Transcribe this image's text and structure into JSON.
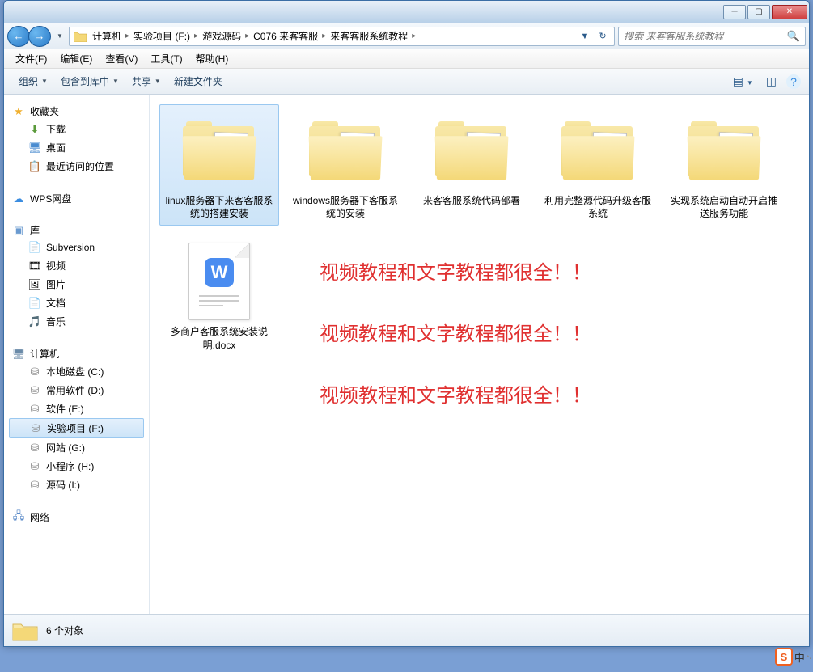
{
  "titlebar": {
    "minimize": "─",
    "maximize": "▢",
    "close": "✕"
  },
  "nav": {
    "back": "←",
    "forward": "→",
    "refresh": "↻",
    "dropdown": "▼"
  },
  "breadcrumbs": [
    "计算机",
    "实验项目 (F:)",
    "游戏源码",
    "C076 来客客服",
    "来客客服系统教程"
  ],
  "search": {
    "placeholder": "搜索 来客客服系统教程",
    "icon": "🔍"
  },
  "menubar": [
    "文件(F)",
    "编辑(E)",
    "查看(V)",
    "工具(T)",
    "帮助(H)"
  ],
  "toolbar": {
    "organize": "组织",
    "include": "包含到库中",
    "share": "共享",
    "newfolder": "新建文件夹",
    "help": "?"
  },
  "sidebar": {
    "favorites": {
      "label": "收藏夹",
      "items": [
        {
          "icon": "⬇",
          "label": "下载",
          "color": "#5a9a3a"
        },
        {
          "icon": "🖥",
          "label": "桌面",
          "color": "#4a8cd0"
        },
        {
          "icon": "📋",
          "label": "最近访问的位置",
          "color": "#8a6a4a"
        }
      ]
    },
    "wps": {
      "icon": "☁",
      "label": "WPS网盘",
      "color": "#3a8ce0"
    },
    "libraries": {
      "label": "库",
      "items": [
        {
          "icon": "📄",
          "label": "Subversion"
        },
        {
          "icon": "🎞",
          "label": "视频"
        },
        {
          "icon": "🖼",
          "label": "图片"
        },
        {
          "icon": "📄",
          "label": "文档"
        },
        {
          "icon": "🎵",
          "label": "音乐",
          "color": "#4a9ae0"
        }
      ]
    },
    "computer": {
      "label": "计算机",
      "items": [
        {
          "label": "本地磁盘 (C:)"
        },
        {
          "label": "常用软件 (D:)"
        },
        {
          "label": "软件 (E:)"
        },
        {
          "label": "实验项目 (F:)",
          "selected": true
        },
        {
          "label": "网站 (G:)"
        },
        {
          "label": "小程序 (H:)"
        },
        {
          "label": "源码 (I:)"
        }
      ]
    },
    "network": {
      "icon": "🖧",
      "label": "网络"
    }
  },
  "files": [
    {
      "type": "folder",
      "label": "linux服务器下来客客服系统的搭建安装",
      "selected": true
    },
    {
      "type": "folder",
      "label": "windows服务器下客服系统的安装"
    },
    {
      "type": "folder",
      "label": "来客客服系统代码部署"
    },
    {
      "type": "folder",
      "label": "利用完整源代码升级客服系统"
    },
    {
      "type": "folder",
      "label": "实现系统启动自动开启推送服务功能"
    },
    {
      "type": "docx",
      "label": "多商户客服系统安装说明.docx"
    }
  ],
  "overlay_texts": [
    "视频教程和文字教程都很全！！",
    "视频教程和文字教程都很全！！",
    "视频教程和文字教程都很全！！"
  ],
  "status": {
    "text": "6 个对象"
  },
  "ime": {
    "logo": "S",
    "lang": "中",
    "punct": "▸"
  }
}
